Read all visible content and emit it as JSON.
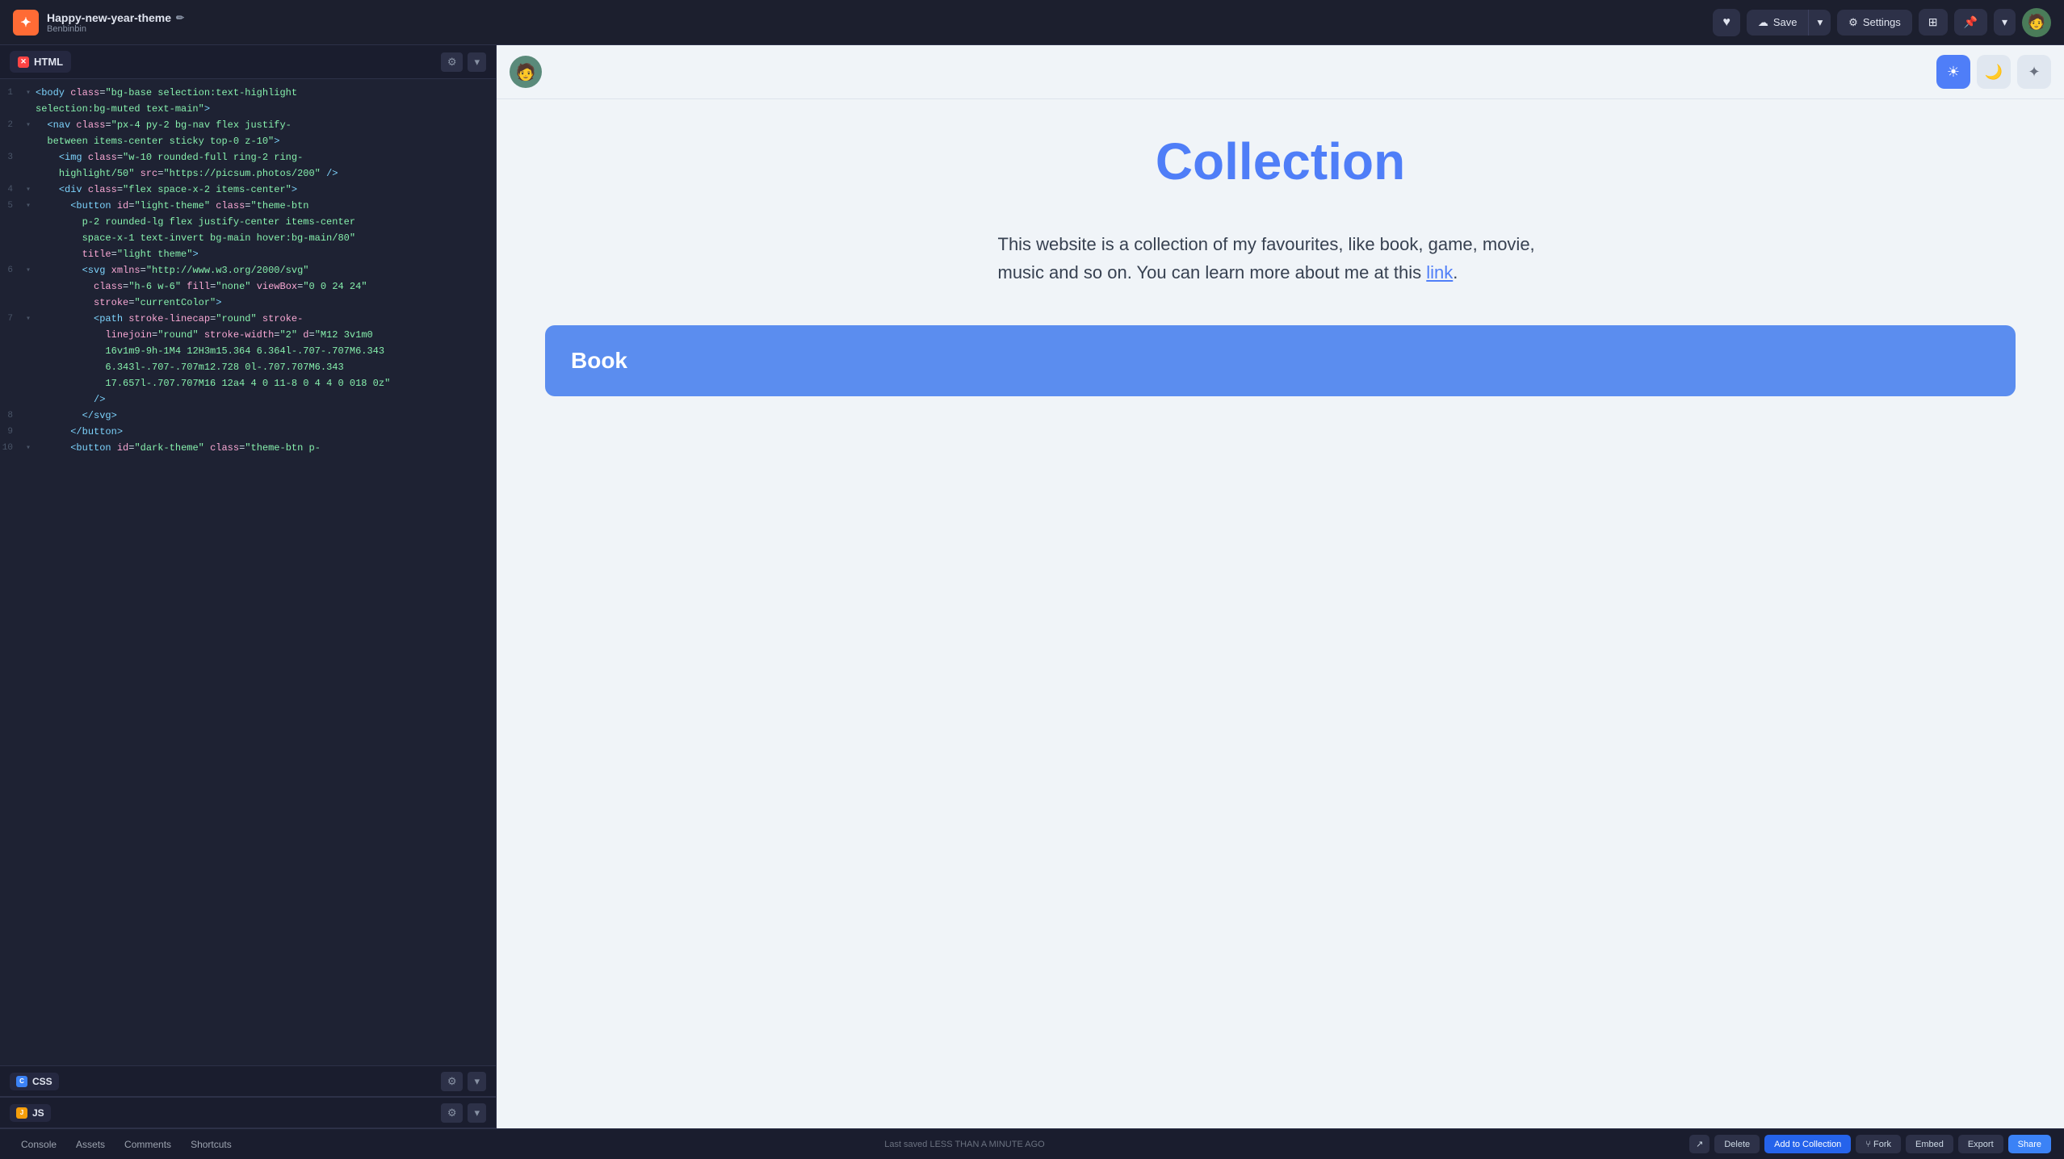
{
  "header": {
    "logo_text": "✦",
    "project_name": "Happy-new-year-theme",
    "edit_icon": "✏",
    "project_owner": "Benbinbin",
    "heart_label": "♥",
    "save_label": "Save",
    "save_icon": "☁",
    "settings_label": "Settings",
    "settings_icon": "⚙",
    "grid_icon": "⊞",
    "pin_icon": "📌",
    "more_icon": "▾",
    "avatar_icon": "🧑"
  },
  "editor": {
    "tab_label": "HTML",
    "tab_indicator": "✕",
    "gear_icon": "⚙",
    "chevron_icon": "▾",
    "lines": [
      {
        "num": "1",
        "arrow": "▾",
        "content": "<span class='tag'>&lt;body</span> <span class='attr-name'>class</span>=<span class='attr-val'>\"bg-base selection:text-highlight</span>"
      },
      {
        "num": "",
        "arrow": "",
        "content": "  <span class='attr-val'>selection:bg-muted text-main\"</span><span class='tag'>&gt;</span>"
      },
      {
        "num": "2",
        "arrow": "▾",
        "content": "  <span class='tag'>&lt;nav</span> <span class='attr-name'>class</span>=<span class='attr-val'>\"px-4 py-2 bg-nav flex justify-</span>"
      },
      {
        "num": "",
        "arrow": "",
        "content": "    <span class='attr-val'>between items-center sticky top-0 z-10\"</span><span class='tag'>&gt;</span>"
      },
      {
        "num": "3",
        "arrow": "",
        "content": "    <span class='tag'>&lt;img</span> <span class='attr-name'>class</span>=<span class='attr-val'>\"w-10 rounded-full ring-2 ring-</span>"
      },
      {
        "num": "",
        "arrow": "",
        "content": "      <span class='attr-val'>highlight/50\"</span> <span class='attr-name'>src</span>=<span class='attr-val'>\"https://picsum.photos/200\"</span> <span class='tag'>/&gt;</span>"
      },
      {
        "num": "4",
        "arrow": "▾",
        "content": "    <span class='tag'>&lt;div</span> <span class='attr-name'>class</span>=<span class='attr-val'>\"flex space-x-2 items-center\"</span><span class='tag'>&gt;</span>"
      },
      {
        "num": "5",
        "arrow": "▾",
        "content": "      <span class='tag'>&lt;button</span> <span class='attr-name'>id</span>=<span class='attr-val'>\"light-theme\"</span> <span class='attr-name'>class</span>=<span class='attr-val'>\"theme-btn</span>"
      },
      {
        "num": "",
        "arrow": "",
        "content": "        <span class='attr-val'>p-2 rounded-lg flex justify-center items-center</span>"
      },
      {
        "num": "",
        "arrow": "",
        "content": "        <span class='attr-val'>space-x-1 text-invert bg-main hover:bg-main/80\"</span>"
      },
      {
        "num": "",
        "arrow": "",
        "content": "        <span class='attr-name'>title</span>=<span class='attr-val'>\"light theme\"</span><span class='tag'>&gt;</span>"
      },
      {
        "num": "6",
        "arrow": "▾",
        "content": "        <span class='tag'>&lt;svg</span> <span class='attr-name'>xmlns</span>=<span class='attr-val'>\"http://www.w3.org/2000/svg\"</span>"
      },
      {
        "num": "",
        "arrow": "",
        "content": "          <span class='attr-name'>class</span>=<span class='attr-val'>\"h-6 w-6\"</span> <span class='attr-name'>fill</span>=<span class='attr-val'>\"none\"</span> <span class='attr-name'>viewBox</span>=<span class='attr-val'>\"0 0 24 24\"</span>"
      },
      {
        "num": "",
        "arrow": "",
        "content": "          <span class='attr-name'>stroke</span>=<span class='attr-val'>\"currentColor\"</span><span class='tag'>&gt;</span>"
      },
      {
        "num": "7",
        "arrow": "▾",
        "content": "          <span class='tag'>&lt;path</span> <span class='attr-name'>stroke-linecap</span>=<span class='attr-val'>\"round\"</span> <span class='attr-name'>stroke-</span>"
      },
      {
        "num": "",
        "arrow": "",
        "content": "            <span class='attr-name'>linejoin</span>=<span class='attr-val'>\"round\"</span> <span class='attr-name'>stroke-width</span>=<span class='attr-val'>\"2\"</span> <span class='attr-name'>d</span>=<span class='attr-val'>\"M12 3v1m0</span>"
      },
      {
        "num": "",
        "arrow": "",
        "content": "            <span class='attr-val'>16v1m9-9h-1M4 12H3m15.364 6.364l-.707-.707M6.343</span>"
      },
      {
        "num": "",
        "arrow": "",
        "content": "            <span class='attr-val'>6.343l-.707-.707m12.728 0l-.707.707M6.343</span>"
      },
      {
        "num": "",
        "arrow": "",
        "content": "            <span class='attr-val'>17.657l-.707.707M16 12a4 4 0 11-8 0 4 4 0 018 0z\"</span>"
      },
      {
        "num": "",
        "arrow": "",
        "content": "          <span class='tag'>/&gt;</span>"
      },
      {
        "num": "8",
        "arrow": "",
        "content": "        <span class='tag'>&lt;/svg&gt;</span>"
      },
      {
        "num": "9",
        "arrow": "",
        "content": "      <span class='tag'>&lt;/button&gt;</span>"
      },
      {
        "num": "10",
        "arrow": "▾",
        "content": "      <span class='tag'>&lt;button</span> <span class='attr-name'>id</span>=<span class='attr-val'>\"dark-theme\"</span> <span class='attr-name'>class</span>=<span class='attr-val'>\"theme-btn p-</span>"
      }
    ],
    "css_tab_label": "CSS",
    "js_tab_label": "JS"
  },
  "preview": {
    "title": "Collection",
    "description": "This website is a collection of my favourites, like book, game, movie, music and so on. You can learn more about me at this",
    "link_text": "link",
    "book_card_title": "Book",
    "theme_sun": "☀",
    "theme_moon": "🌙",
    "theme_star": "✦"
  },
  "status_bar": {
    "console_label": "Console",
    "assets_label": "Assets",
    "comments_label": "Comments",
    "shortcuts_label": "Shortcuts",
    "last_saved_text": "Last saved LESS THAN A MINUTE AGO",
    "open_icon": "↗",
    "delete_label": "Delete",
    "add_collection_label": "Add to Collection",
    "fork_icon": "⑂",
    "fork_label": "Fork",
    "embed_label": "Embed",
    "export_label": "Export",
    "share_label": "Share"
  }
}
